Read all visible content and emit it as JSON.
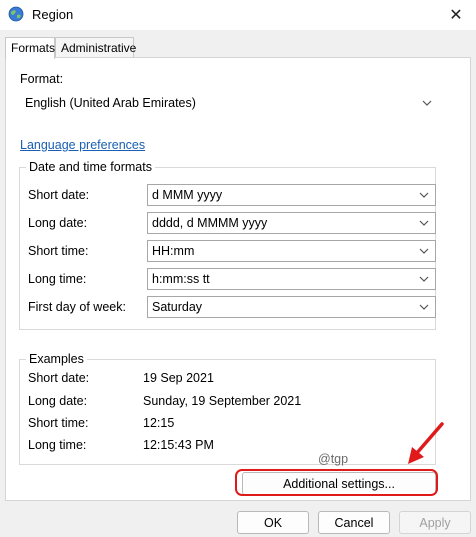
{
  "window": {
    "title": "Region",
    "close_glyph": "✕"
  },
  "tabs": [
    {
      "label": "Formats",
      "active": true
    },
    {
      "label": "Administrative",
      "active": false
    }
  ],
  "format": {
    "label": "Format:",
    "value": "English (United Arab Emirates)"
  },
  "language_link": "Language preferences",
  "date_time": {
    "legend": "Date and time formats",
    "rows": [
      {
        "label": "Short date:",
        "value": "d MMM yyyy"
      },
      {
        "label": "Long date:",
        "value": "dddd, d MMMM yyyy"
      },
      {
        "label": "Short time:",
        "value": "HH:mm"
      },
      {
        "label": "Long time:",
        "value": "h:mm:ss tt"
      },
      {
        "label": "First day of week:",
        "value": "Saturday"
      }
    ]
  },
  "examples": {
    "legend": "Examples",
    "rows": [
      {
        "label": "Short date:",
        "value": "19 Sep 2021"
      },
      {
        "label": "Long date:",
        "value": "Sunday, 19 September 2021"
      },
      {
        "label": "Short time:",
        "value": "12:15"
      },
      {
        "label": "Long time:",
        "value": "12:15:43 PM"
      }
    ]
  },
  "watermark": "@tgp",
  "additional_settings": "Additional settings...",
  "footer": {
    "ok": "OK",
    "cancel": "Cancel",
    "apply": "Apply"
  },
  "colors": {
    "highlight": "#e01a1a",
    "link": "#1a5fb4"
  }
}
